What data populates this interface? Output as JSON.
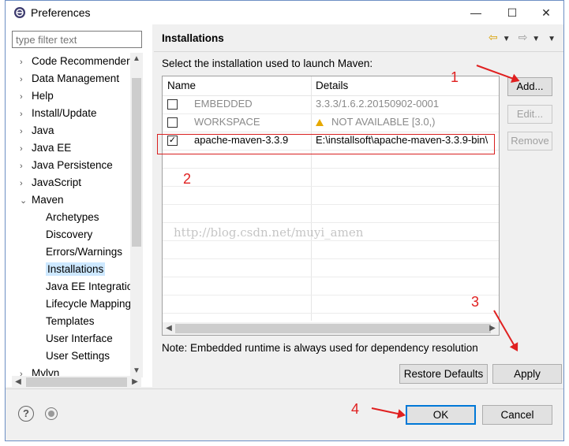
{
  "window": {
    "title": "Preferences",
    "controls": [
      "—",
      "☐",
      "✕"
    ]
  },
  "left_pane": {
    "filter_placeholder": "type filter text",
    "tree": [
      {
        "label": "Code Recommenders",
        "level": 0,
        "expandable": true,
        "expanded": false
      },
      {
        "label": "Data Management",
        "level": 0,
        "expandable": true,
        "expanded": false
      },
      {
        "label": "Help",
        "level": 0,
        "expandable": true,
        "expanded": false
      },
      {
        "label": "Install/Update",
        "level": 0,
        "expandable": true,
        "expanded": false
      },
      {
        "label": "Java",
        "level": 0,
        "expandable": true,
        "expanded": false
      },
      {
        "label": "Java EE",
        "level": 0,
        "expandable": true,
        "expanded": false
      },
      {
        "label": "Java Persistence",
        "level": 0,
        "expandable": true,
        "expanded": false
      },
      {
        "label": "JavaScript",
        "level": 0,
        "expandable": true,
        "expanded": false
      },
      {
        "label": "Maven",
        "level": 0,
        "expandable": true,
        "expanded": true
      },
      {
        "label": "Archetypes",
        "level": 1,
        "expandable": false
      },
      {
        "label": "Discovery",
        "level": 1,
        "expandable": false
      },
      {
        "label": "Errors/Warnings",
        "level": 1,
        "expandable": false
      },
      {
        "label": "Installations",
        "level": 1,
        "expandable": false,
        "selected": true
      },
      {
        "label": "Java EE Integration",
        "level": 1,
        "expandable": false
      },
      {
        "label": "Lifecycle Mappings",
        "level": 1,
        "expandable": false
      },
      {
        "label": "Templates",
        "level": 1,
        "expandable": false
      },
      {
        "label": "User Interface",
        "level": 1,
        "expandable": false
      },
      {
        "label": "User Settings",
        "level": 1,
        "expandable": false
      },
      {
        "label": "Mylyn",
        "level": 0,
        "expandable": true,
        "expanded": false
      }
    ]
  },
  "right_pane": {
    "title": "Installations",
    "instruction": "Select the installation used to launch Maven:",
    "columns": {
      "name": "Name",
      "details": "Details"
    },
    "rows": [
      {
        "checked": false,
        "name": "EMBEDDED",
        "details": "3.3.3/1.6.2.20150902-0001",
        "grayed": true,
        "warning": false
      },
      {
        "checked": false,
        "name": "WORKSPACE",
        "details": "NOT AVAILABLE [3.0,)",
        "grayed": true,
        "warning": true
      },
      {
        "checked": true,
        "name": "apache-maven-3.3.9",
        "details": "E:\\installsoft\\apache-maven-3.3.9-bin\\",
        "grayed": false,
        "warning": false
      }
    ],
    "buttons": {
      "add": "Add...",
      "edit": "Edit...",
      "remove": "Remove"
    },
    "note": "Note: Embedded runtime is always used for dependency resolution",
    "restore_defaults": "Restore Defaults",
    "apply": "Apply"
  },
  "footer": {
    "ok": "OK",
    "cancel": "Cancel"
  },
  "annotations": [
    "1",
    "2",
    "3",
    "4"
  ],
  "watermark": "http://blog.csdn.net/muyi_amen",
  "colors": {
    "annotation": "#e02020",
    "selection": "#cde8ff",
    "default_button_border": "#0078d7"
  }
}
